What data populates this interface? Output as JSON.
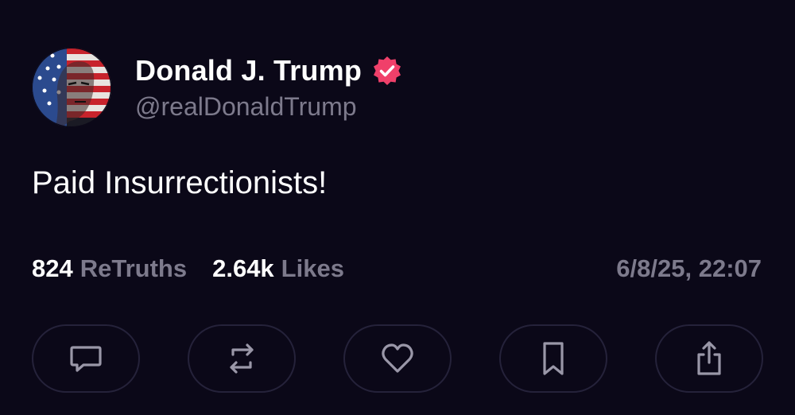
{
  "account": {
    "display_name": "Donald J. Trump",
    "handle": "@realDonaldTrump",
    "verified": true,
    "verified_badge_color": "#f0406a"
  },
  "post": {
    "text": "Paid Insurrectionists!",
    "timestamp": "6/8/25, 22:07"
  },
  "stats": {
    "retruths_count": "824",
    "retruths_label": "ReTruths",
    "likes_count": "2.64k",
    "likes_label": "Likes"
  },
  "actions": [
    {
      "icon": "reply-icon"
    },
    {
      "icon": "retruth-icon"
    },
    {
      "icon": "heart-icon"
    },
    {
      "icon": "bookmark-icon"
    },
    {
      "icon": "share-icon"
    }
  ],
  "colors": {
    "background": "#0b0818",
    "muted_text": "#7d7a8c",
    "action_border": "#25223a",
    "icon_stroke": "#9a97a8"
  }
}
